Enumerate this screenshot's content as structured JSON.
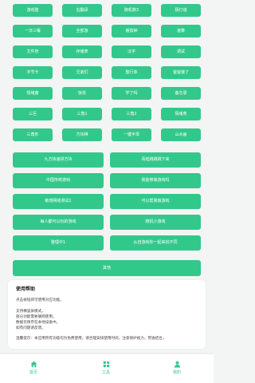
{
  "colors": {
    "accent": "#33c88b",
    "background": "#f3f5f4",
    "card": "#ffffff"
  },
  "grid_buttons": [
    "游戏整",
    "右翻译",
    "随机数3",
    "猜灯谜",
    "一日三餐",
    "全部游",
    "番茄钟",
    "速算",
    "文件管",
    "存储表",
    "汉字",
    "调试",
    "字节卡",
    "兄弟们",
    "整行体",
    "爸爸饿了",
    "情绪酱",
    "饭低",
    "学了吗",
    "备忘录",
    "三巨",
    "三角1",
    "三角2",
    "情绪表",
    "三角形",
    "方块棋",
    "一键字母",
    "山水画"
  ],
  "wide_buttons": [
    "九方快速拼方块",
    "青蛙跳跳跳下来",
    "中国传统游戏",
    "我能够做游戏吗",
    "敏感网络测试1",
    "可以帮我做游戏",
    "每人都可以玩的游戏",
    "随机小游戏",
    "整理中1",
    "从自游戏你一起来找不同"
  ],
  "full_button": "其他",
  "help": {
    "title": "使用帮助",
    "intro": "点击按钮即可使用对应功能。",
    "notes": [
      "支持横竖屏模式。",
      "部分功能需要联网使用。",
      "数据仅保存在本地设备中。",
      "如有问题请反馈。"
    ],
    "tip": "温馨提示：本应用所有功能均为免费使用，请合理安排使用时间，注意保护视力，劳逸结合。"
  },
  "nav": [
    {
      "label": "首页",
      "icon": "home-icon"
    },
    {
      "label": "工具",
      "icon": "category-icon"
    },
    {
      "label": "我的",
      "icon": "user-icon"
    }
  ]
}
